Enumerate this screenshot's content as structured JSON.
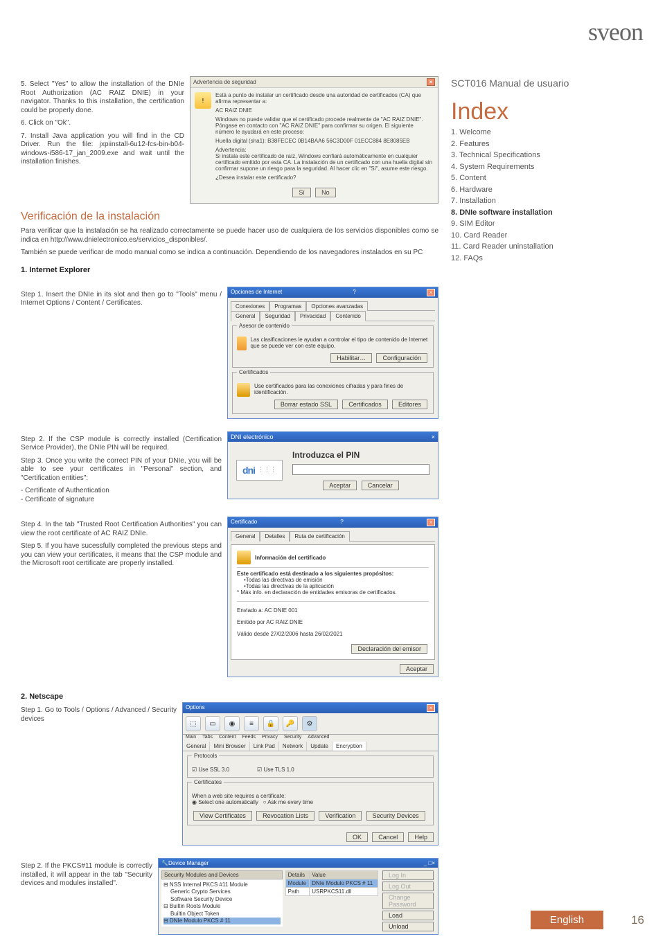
{
  "logo": "sveon",
  "sidebar": {
    "manualTitle": "SCT016 Manual de usuario",
    "indexTitle": "Index",
    "items": [
      {
        "label": "1. Welcome",
        "bold": false
      },
      {
        "label": "2. Features",
        "bold": false
      },
      {
        "label": "3. Technical Specifications",
        "bold": false
      },
      {
        "label": "4. System Requirements",
        "bold": false
      },
      {
        "label": "5. Content",
        "bold": false
      },
      {
        "label": "6. Hardware",
        "bold": false
      },
      {
        "label": "7. Installation",
        "bold": false
      },
      {
        "label": "8. DNIe software installation",
        "bold": true
      },
      {
        "label": "9. SIM Editor",
        "bold": false
      },
      {
        "label": "10. Card Reader",
        "bold": false
      },
      {
        "label": "11. Card Reader uninstallation",
        "bold": false
      },
      {
        "label": "12. FAQs",
        "bold": false
      }
    ]
  },
  "intro": {
    "p5": "5. Select \"Yes\" to allow the installation of the DNIe Root Authorization (AC RAIZ DNIE) in your navigator. Thanks to this installation, the certification could be properly done.",
    "p6": "6. Click on \"Ok\".",
    "p7": "7. Install Java application you will find in the CD Driver. Run the file: jxpiinstall-6u12-fcs-bin-b04-windows-i586-17_jan_2009.exe and wait until the installation finishes."
  },
  "secwarn": {
    "title": "Advertencia de seguridad",
    "l1": "Está a punto de instalar un certificado desde una autoridad de certificados (CA) que afirma representar a:",
    "l2": "AC RAIZ DNIE",
    "l3": "Windows no puede validar que el certificado procede realmente de \"AC RAIZ DNIE\". Póngase en contacto con \"AC RAIZ DNIE\" para confirmar su origen. El siguiente número le ayudará en este proceso:",
    "l4": "Huella digital (sha1): B38FECEC 0B14BAA6 56C3D00F 01ECC884 8E8085EB",
    "l5": "Advertencia:",
    "l6": "Si instala este certificado de raíz, Windows confiará automáticamente en cualquier certificado emitido por esta CA. La instalación de un certificado con una huella digital sin confirmar supone un riesgo para la seguridad. Al hacer clic en \"Sí\", asume este riesgo.",
    "l7": "¿Desea instalar este certificado?",
    "yes": "Sí",
    "no": "No"
  },
  "verif": {
    "h": "Verificación de la instalación",
    "p1": "Para verificar que la instalación se ha realizado correctamente se puede hacer uso de cualquiera de los servicios disponibles como se indica en http://www.dnielectronico.es/servicios_disponibles/.",
    "p2": "También se puede verificar de modo manual como se indica a continuación. Dependiendo de los navegadores instalados en su PC"
  },
  "ie": {
    "h": "1. Internet Explorer",
    "s1": "Step 1. Insert the DNIe in its slot and then go to \"Tools\" menu / Internet Options / Content / Certificates.",
    "win": {
      "title": "Opciones de Internet",
      "tabs1": [
        "Conexiones",
        "Programas",
        "Opciones avanzadas"
      ],
      "tabs2": [
        "General",
        "Seguridad",
        "Privacidad",
        "Contenido"
      ],
      "g1t": "Asesor de contenido",
      "g1": "Las clasificaciones le ayudan a controlar el tipo de contenido de Internet que se puede ver con este equipo.",
      "b1": "Habilitar…",
      "b2": "Configuración",
      "g2t": "Certificados",
      "g2": "Use certificados para las conexiones cifradas y para fines de identificación.",
      "b3": "Borrar estado SSL",
      "b4": "Certificados",
      "b5": "Editores"
    },
    "s2": "Step 2. If the CSP module is correctly installed (Certification Service Provider), the DNIe PIN will be required.",
    "s3": "Step 3. Once you write the correct PIN of your DNIe, you will be able to see your certificates in \"Personal\" section, and \"Certification entities\":",
    "s3a": "- Certificate of Authentication",
    "s3b": "- Certificate of signature",
    "pin": {
      "title": "DNI electrónico",
      "label": "Introduzca el PIN",
      "ok": "Aceptar",
      "cancel": "Cancelar"
    },
    "s4": "Step 4. In the tab \"Trusted Root Certification Authorities\" you can view the root certificate of AC RAIZ DNIe.",
    "s5": "Step 5. If you have sucessfully completed the previous steps and you can view your certificates, it means that the CSP module and the Microsoft root certificate are properly installed.",
    "cert": {
      "title": "Certificado",
      "tabs": [
        "General",
        "Detalles",
        "Ruta de certificación"
      ],
      "info": "Información del certificado",
      "purp": "Este certificado está destinado a los siguientes propósitos:",
      "li1": "•Todas las directivas de emisión",
      "li2": "•Todas las directivas de la aplicación",
      "li3": "* Más info. en declaración de entidades emisoras de certificados.",
      "to": "Enviado a:  AC DNIE 001",
      "by": "Emitido por AC RAIZ DNIE",
      "valid": "Válido desde 27/02/2006 hasta 26/02/2021",
      "decl": "Declaración del emisor",
      "ok": "Aceptar"
    }
  },
  "ns": {
    "h": "2. Netscape",
    "s1": "Step 1. Go to Tools / Options / Advanced / Security devices",
    "win": {
      "title": "Options",
      "icons": [
        "Main",
        "Tabs",
        "Content",
        "Feeds",
        "Privacy",
        "Security",
        "Advanced"
      ],
      "subtabs": [
        "General",
        "Mini Browser",
        "Link Pad",
        "Network",
        "Update",
        "Encryption"
      ],
      "g1": "Protocols",
      "ssl": "Use SSL 3.0",
      "tls": "Use TLS 1.0",
      "g2": "Certificates",
      "q": "When a web site requires a certificate:",
      "r1": "Select one automatically",
      "r2": "Ask me every time",
      "b1": "View Certificates",
      "b2": "Revocation Lists",
      "b3": "Verification",
      "b4": "Security Devices",
      "ok": "OK",
      "cancel": "Cancel",
      "help": "Help"
    },
    "s2": "Step 2. If the PKCS#11 module is correctly installed, it will appear in the tab \"Security devices and modules installed\".",
    "dm": {
      "title": "Device Manager",
      "col1": "Security Modules and Devices",
      "col2": "Details",
      "col3": "Value",
      "tree": [
        "⊟ NSS Internal PKCS #11 Module",
        "  Generic Crypto Services",
        "  Software Security Device",
        "⊟ Builtin Roots Module",
        "  Builtin Object Token",
        "⊟ DNIe Modulo PKCS # 11"
      ],
      "det": [
        [
          "Module",
          "DNIe Modulo PKCS # 11"
        ],
        [
          "Path",
          "USRPKCS11.dll"
        ]
      ],
      "btns": [
        "Log In",
        "Log Out",
        "Change Password",
        "Load",
        "Unload"
      ]
    }
  },
  "footer": {
    "lang": "English",
    "page": "16"
  }
}
